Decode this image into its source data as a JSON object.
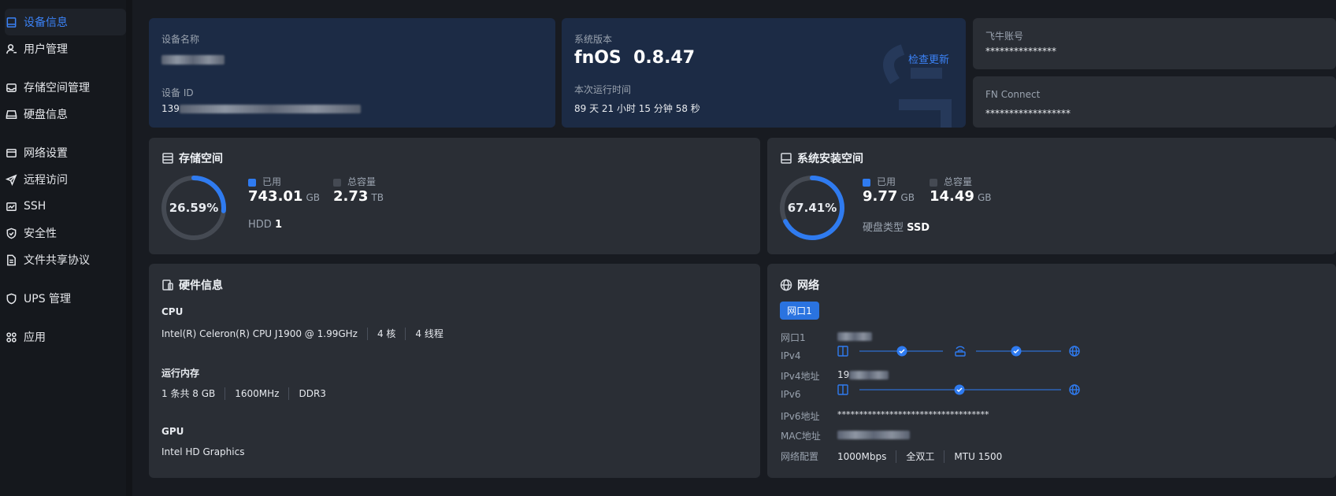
{
  "sidebar": {
    "items": [
      {
        "label": "设备信息",
        "icon": "monitor-icon",
        "active": true
      },
      {
        "label": "用户管理",
        "icon": "user-icon"
      },
      {
        "label": "存储空间管理",
        "icon": "storage-icon"
      },
      {
        "label": "硬盘信息",
        "icon": "disk-icon"
      },
      {
        "label": "网络设置",
        "icon": "network-icon"
      },
      {
        "label": "远程访问",
        "icon": "send-icon"
      },
      {
        "label": "SSH",
        "icon": "terminal-icon"
      },
      {
        "label": "安全性",
        "icon": "shield-check-icon"
      },
      {
        "label": "文件共享协议",
        "icon": "file-icon"
      },
      {
        "label": "UPS 管理",
        "icon": "shield-icon"
      },
      {
        "label": "应用",
        "icon": "apps-icon"
      }
    ]
  },
  "device": {
    "name_label": "设备名称",
    "id_label": "设备 ID",
    "id_prefix": "139"
  },
  "system": {
    "version_label": "系统版本",
    "version": "fnOS  0.8.47",
    "check_update": "检查更新",
    "uptime_label": "本次运行时间",
    "uptime": "89 天 21 小时 15 分钟 58 秒"
  },
  "account": {
    "label": "飞牛账号",
    "value": "***************"
  },
  "fnconnect": {
    "label": "FN Connect",
    "value": "******************"
  },
  "storage": {
    "title": "存储空间",
    "percent": "26.59%",
    "percent_value": 26.59,
    "used_label": "已用",
    "used_value": "743.01",
    "used_unit": "GB",
    "total_label": "总容量",
    "total_value": "2.73",
    "total_unit": "TB",
    "hdd_label": "HDD",
    "hdd_count": "1"
  },
  "sysspace": {
    "title": "系统安装空间",
    "percent": "67.41%",
    "percent_value": 67.41,
    "used_label": "已用",
    "used_value": "9.77",
    "used_unit": "GB",
    "total_label": "总容量",
    "total_value": "14.49",
    "total_unit": "GB",
    "disk_type_label": "硬盘类型",
    "disk_type": "SSD"
  },
  "hardware": {
    "title": "硬件信息",
    "cpu_label": "CPU",
    "cpu_model": "Intel(R) Celeron(R) CPU J1900 @ 1.99GHz",
    "cpu_cores": "4 核",
    "cpu_threads": "4 线程",
    "mem_label": "运行内存",
    "mem_count": "1 条共 8 GB",
    "mem_speed": "1600MHz",
    "mem_type": "DDR3",
    "gpu_label": "GPU",
    "gpu_model": "Intel HD Graphics"
  },
  "network": {
    "title": "网络",
    "tab": "网口1",
    "port_label": "网口1",
    "ipv4_label": "IPv4",
    "ipv4_addr_label": "IPv4地址",
    "ipv4_addr_prefix": "19",
    "ipv6_label": "IPv6",
    "ipv6_addr_label": "IPv6地址",
    "ipv6_addr": "***********************************",
    "mac_label": "MAC地址",
    "config_label": "网络配置",
    "speed": "1000Mbps",
    "duplex": "全双工",
    "mtu": "MTU 1500"
  },
  "colors": {
    "accent": "#2f7bf0",
    "ring_track": "#454a53"
  }
}
